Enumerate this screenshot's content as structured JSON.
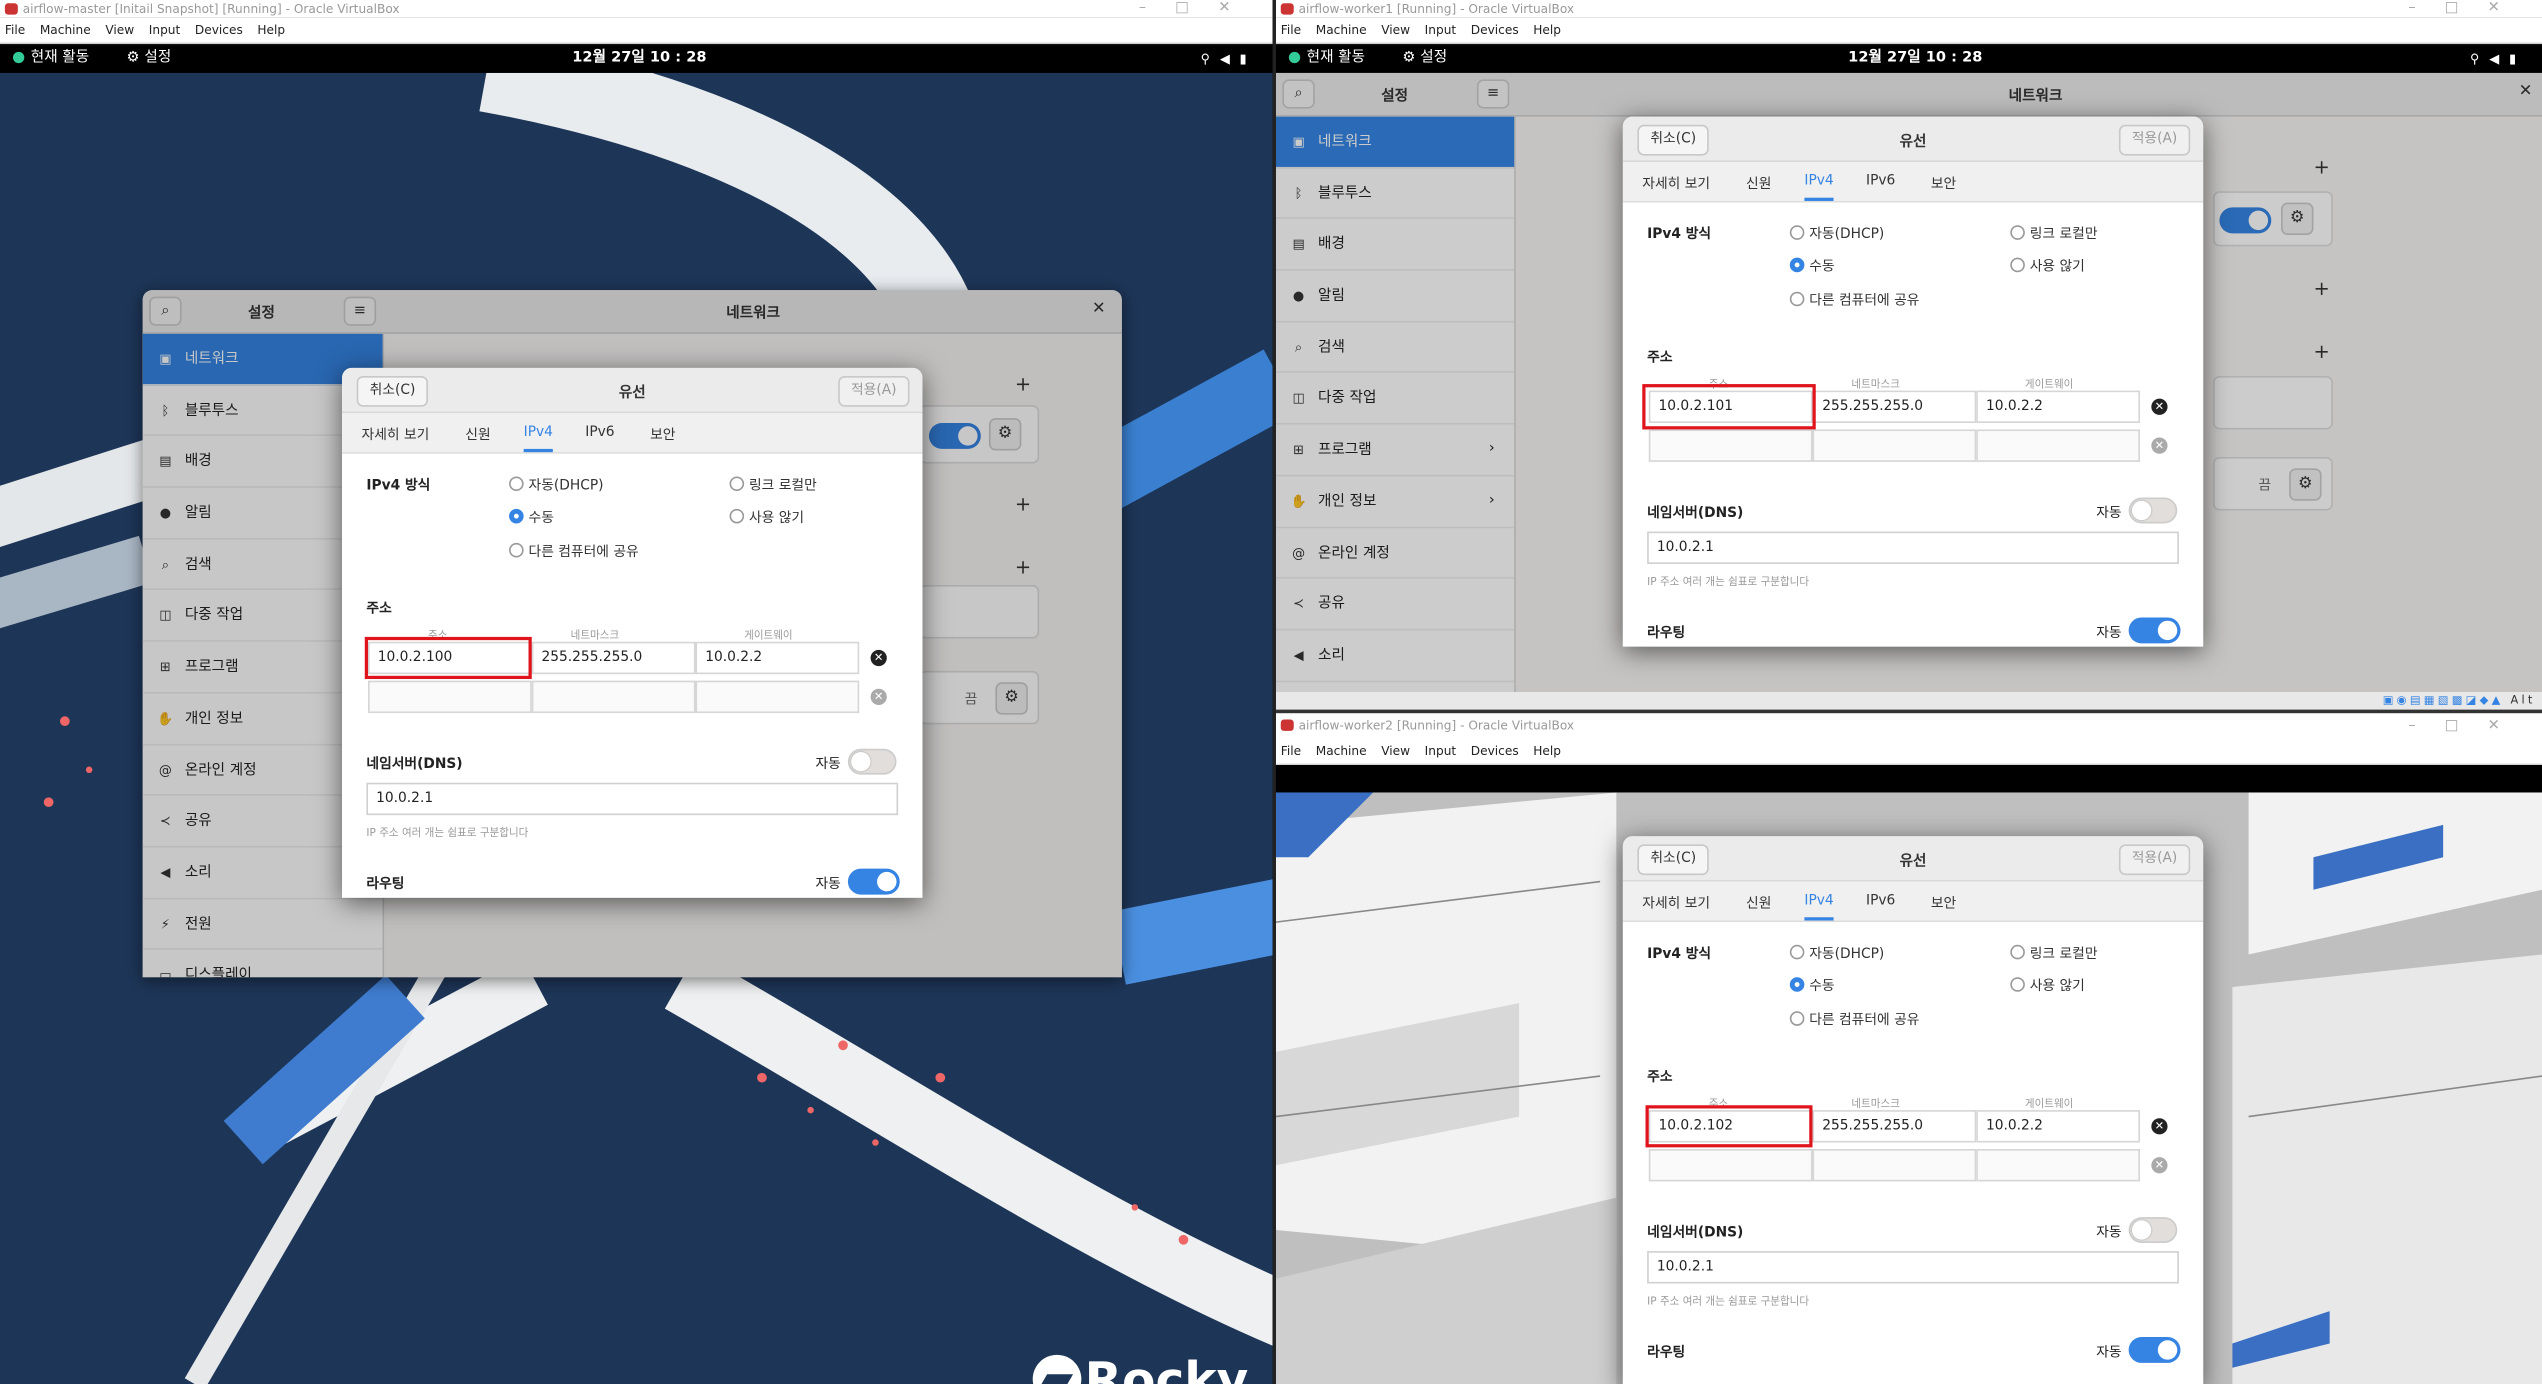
{
  "menu": {
    "file": "File",
    "machine": "Machine",
    "view": "View",
    "input": "Input",
    "devices": "Devices",
    "help": "Help"
  },
  "gnome": {
    "activities": "현재 활동",
    "settings": "설정",
    "clock": "12월 27일  10 : 28"
  },
  "settings": {
    "title": "설정",
    "panel_title": "네트워크",
    "sidebar": [
      "네트워크",
      "블루투스",
      "배경",
      "알림",
      "검색",
      "다중 작업",
      "프로그램",
      "개인 정보",
      "온라인 계정",
      "공유",
      "소리",
      "전원",
      "디스플레이"
    ],
    "off": "끔"
  },
  "dialog": {
    "cancel": "취소(C)",
    "title": "유선",
    "apply": "적용(A)",
    "tabs": [
      "자세히 보기",
      "신원",
      "IPv4",
      "IPv6",
      "보안"
    ],
    "ipv4_method": "IPv4 방식",
    "methods": {
      "dhcp": "자동(DHCP)",
      "link_local": "링크 로컬만",
      "manual": "수동",
      "disabled": "사용 않기",
      "share": "다른 컴퓨터에 공유"
    },
    "address_section": "주소",
    "col_address": "주소",
    "col_netmask": "네트마스크",
    "col_gateway": "게이트웨이",
    "dns": "네임서버(DNS)",
    "auto": "자동",
    "dns_hint": "IP 주소 여러 개는 쉼표로 구분합니다",
    "routing": "라우팅"
  },
  "vms": [
    {
      "title": "airflow-master [Initail Snapshot] [Running] - Oracle VirtualBox",
      "address": "10.0.2.100",
      "netmask": "255.255.255.0",
      "gateway": "10.0.2.2",
      "dns": "10.0.2.1"
    },
    {
      "title": "airflow-worker1 [Running] - Oracle VirtualBox",
      "address": "10.0.2.101",
      "netmask": "255.255.255.0",
      "gateway": "10.0.2.2",
      "dns": "10.0.2.1"
    },
    {
      "title": "airflow-worker2 [Running] - Oracle VirtualBox",
      "address": "10.0.2.102",
      "netmask": "255.255.255.0",
      "gateway": "10.0.2.2",
      "dns": "10.0.2.1"
    }
  ],
  "desktop": {
    "logo_text": "Rocky"
  },
  "host_tray": {
    "alt": "Alt"
  },
  "colors": {
    "accent": "#3584e4",
    "highlight": "#e0141c",
    "desktop": "#1d3557"
  }
}
